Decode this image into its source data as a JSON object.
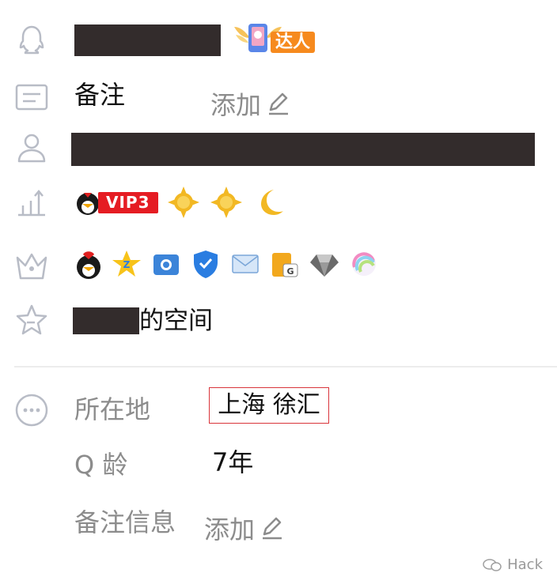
{
  "talent_badge": {
    "label": "达人"
  },
  "remark": {
    "label": "备注",
    "action": "添加"
  },
  "level": {
    "vip_label": "VIP3"
  },
  "space": {
    "suffix": "的空间"
  },
  "info": {
    "location_label": "所在地",
    "location_value": "上海 徐汇",
    "qage_label": "Q 龄",
    "qage_value": "7年",
    "remark_info_label": "备注信息",
    "remark_info_action": "添加"
  },
  "watermark": {
    "text": "Hack"
  }
}
